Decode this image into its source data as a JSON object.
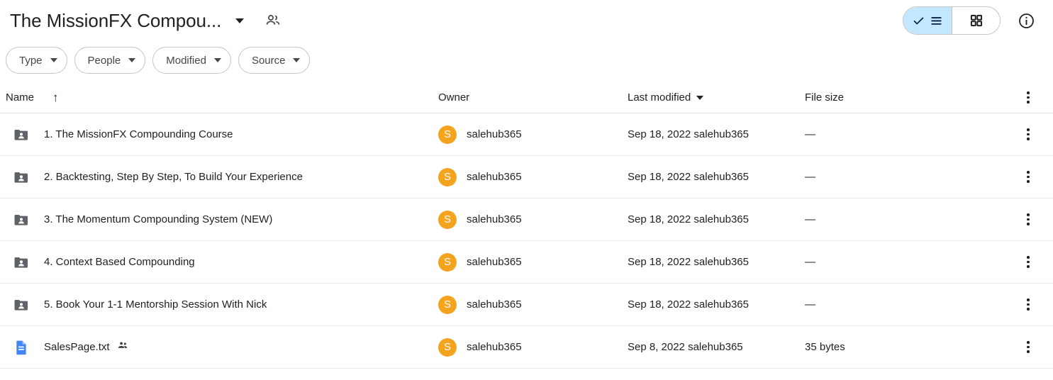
{
  "header": {
    "title": "The MissionFX Compou...",
    "title_caret_icon": "chevron-down-icon",
    "people_icon": "people-icon",
    "view_toggle": {
      "list_label": "",
      "list_icon": "list-view-icon",
      "list_check_icon": "check-icon",
      "list_selected": true,
      "grid_icon": "grid-view-icon",
      "grid_selected": false,
      "active_bg": "#C2E7FF"
    },
    "info_icon": "info-circle-icon"
  },
  "filters": [
    {
      "label": "Type",
      "icon": "chevron-down-icon"
    },
    {
      "label": "People",
      "icon": "chevron-down-icon"
    },
    {
      "label": "Modified",
      "icon": "chevron-down-icon"
    },
    {
      "label": "Source",
      "icon": "chevron-down-icon"
    }
  ],
  "table": {
    "columns": {
      "name": "Name",
      "name_sort_icon": "arrow-up-icon",
      "owner": "Owner",
      "last_modified": "Last modified",
      "last_modified_caret_icon": "chevron-down-icon",
      "file_size": "File size",
      "more_icon": "kebab-menu-icon"
    },
    "rows": [
      {
        "icon": "shared-folder-icon",
        "icon_color": "#5F6368",
        "name": "1. The MissionFX Compounding Course",
        "shared_badge": "",
        "owner_initial": "S",
        "owner": "salehub365",
        "last_modified": "Sep 18, 2022 salehub365",
        "file_size": "—",
        "more_icon": "kebab-menu-icon"
      },
      {
        "icon": "shared-folder-icon",
        "icon_color": "#5F6368",
        "name": "2. Backtesting, Step By Step, To Build Your Experience",
        "shared_badge": "",
        "owner_initial": "S",
        "owner": "salehub365",
        "last_modified": "Sep 18, 2022 salehub365",
        "file_size": "—",
        "more_icon": "kebab-menu-icon"
      },
      {
        "icon": "shared-folder-icon",
        "icon_color": "#5F6368",
        "name": "3. The Momentum Compounding System (NEW)",
        "shared_badge": "",
        "owner_initial": "S",
        "owner": "salehub365",
        "last_modified": "Sep 18, 2022 salehub365",
        "file_size": "—",
        "more_icon": "kebab-menu-icon"
      },
      {
        "icon": "shared-folder-icon",
        "icon_color": "#5F6368",
        "name": "4. Context Based Compounding",
        "shared_badge": "",
        "owner_initial": "S",
        "owner": "salehub365",
        "last_modified": "Sep 18, 2022 salehub365",
        "file_size": "—",
        "more_icon": "kebab-menu-icon"
      },
      {
        "icon": "shared-folder-icon",
        "icon_color": "#5F6368",
        "name": "5. Book Your 1-1 Mentorship Session With Nick",
        "shared_badge": "",
        "owner_initial": "S",
        "owner": "salehub365",
        "last_modified": "Sep 18, 2022 salehub365",
        "file_size": "—",
        "more_icon": "kebab-menu-icon"
      },
      {
        "icon": "text-document-icon",
        "icon_color": "#4285F4",
        "name": "SalesPage.txt",
        "shared_badge": "people-shared-icon",
        "owner_initial": "S",
        "owner": "salehub365",
        "last_modified": "Sep 8, 2022 salehub365",
        "file_size": "35 bytes",
        "more_icon": "kebab-menu-icon"
      }
    ]
  },
  "colors": {
    "avatar": "#F4A41C",
    "doc_blue": "#4285F4",
    "folder_gray": "#5F6368",
    "toggle_active": "#C2E7FF"
  }
}
